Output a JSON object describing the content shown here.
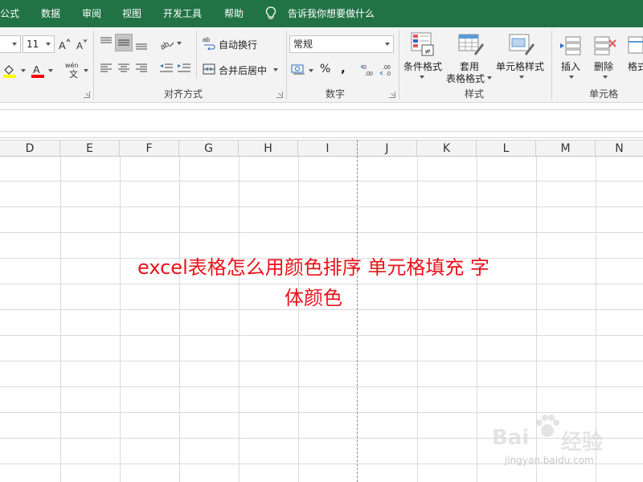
{
  "menu_tabs": [
    "公式",
    "数据",
    "审阅",
    "视图",
    "开发工具",
    "帮助"
  ],
  "tell_me": "告诉我你想要做什么",
  "font": {
    "size": "11"
  },
  "alignment": {
    "wrap_text": "自动换行",
    "merge_center": "合并后居中",
    "group_label": "对齐方式"
  },
  "number": {
    "format": "常规",
    "percent": "%",
    "comma": ",",
    "group_label": "数字"
  },
  "styles": {
    "conditional": "条件格式",
    "table_line1": "套用",
    "table_line2": "表格格式",
    "cell_styles": "单元格样式",
    "group_label": "样式"
  },
  "cells": {
    "insert": "插入",
    "delete": "删除",
    "format": "格式",
    "group_label": "单元格"
  },
  "columns": [
    "D",
    "E",
    "F",
    "G",
    "H",
    "I",
    "J",
    "K",
    "L",
    "M",
    "N"
  ],
  "overlay": {
    "line1": "excel表格怎么用颜色排序 单元格填充 字",
    "line2": "体颜色"
  },
  "watermark": {
    "brand": "Bai",
    "suffix": "经验",
    "url": "jingyan.baidu.com"
  },
  "colors": {
    "tab_bar": "#217346",
    "overlay_text": "#e8121b"
  }
}
